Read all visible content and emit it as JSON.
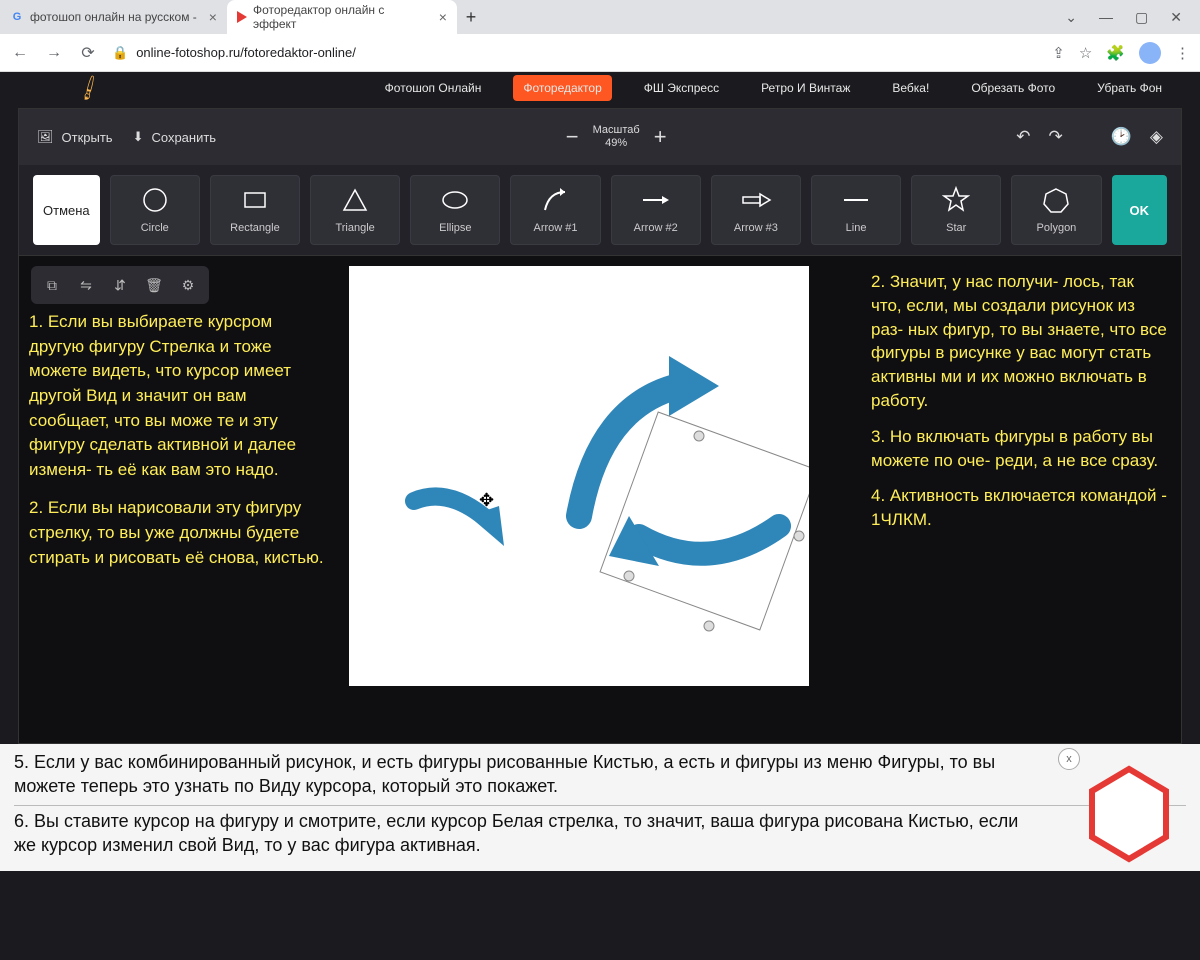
{
  "browser": {
    "tabs": [
      {
        "title": "фотошоп онлайн на русском -",
        "active": false
      },
      {
        "title": "Фоторедактор онлайн с эффект",
        "active": true
      }
    ],
    "url": "online-fotoshop.ru/fotoredaktor-online/",
    "win_min": "—",
    "win_max": "▢",
    "win_close": "✕",
    "win_down": "⌄"
  },
  "nav": {
    "items": [
      "Фотошоп Онлайн",
      "Фоторедактор",
      "ФШ Экспресс",
      "Ретро И Винтаж",
      "Вебка!",
      "Обрезать Фото",
      "Убрать Фон"
    ],
    "active_index": 1
  },
  "toolbar": {
    "open": "Открыть",
    "save": "Сохранить",
    "zoom_label": "Масштаб",
    "zoom_value": "49%"
  },
  "shapes": {
    "cancel": "Отмена",
    "ok": "OK",
    "items": [
      {
        "label": "Circle"
      },
      {
        "label": "Rectangle"
      },
      {
        "label": "Triangle"
      },
      {
        "label": "Ellipse"
      },
      {
        "label": "Arrow #1"
      },
      {
        "label": "Arrow #2"
      },
      {
        "label": "Arrow #3"
      },
      {
        "label": "Line"
      },
      {
        "label": "Star"
      },
      {
        "label": "Polygon"
      }
    ]
  },
  "annotations": {
    "left_1": "1. Если вы выбираете курсром другую фигуру Стрелка и тоже можете видеть, что курсор имеет другой Вид и значит он вам сообщает, что вы може те и эту фигуру сделать активной и далее изменя- ть её как вам это надо.",
    "left_2": "2. Если вы нарисовали эту фигуру стрелку, то вы уже должны будете стирать и рисовать её снова, кистью.",
    "right_2": "2. Значит, у нас получи- лось, так что, если, мы создали рисунок из раз- ных фигур, то вы знаете, что все фигуры в рисунке у вас могут стать активны ми и их можно включать в работу.",
    "right_3": "3. Но включать фигуры в работу вы можете по оче- реди, а не все сразу.",
    "right_4": "4. Активность включается командой - 1ЧЛКМ.",
    "bottom_5": "5. Если у вас комбинированный рисунок, и есть фигуры рисованные Кистью, а есть и фигуры из меню Фигуры, то вы можете теперь это узнать по Виду курсора, который это покажет.",
    "bottom_6": "6. Вы ставите курсор на фигуру и смотрите, если курсор Белая стрелка, то значит, ваша фигура рисована Кистью, если же курсор изменил свой Вид, то у вас фигура активная.",
    "close_badge": "x"
  }
}
